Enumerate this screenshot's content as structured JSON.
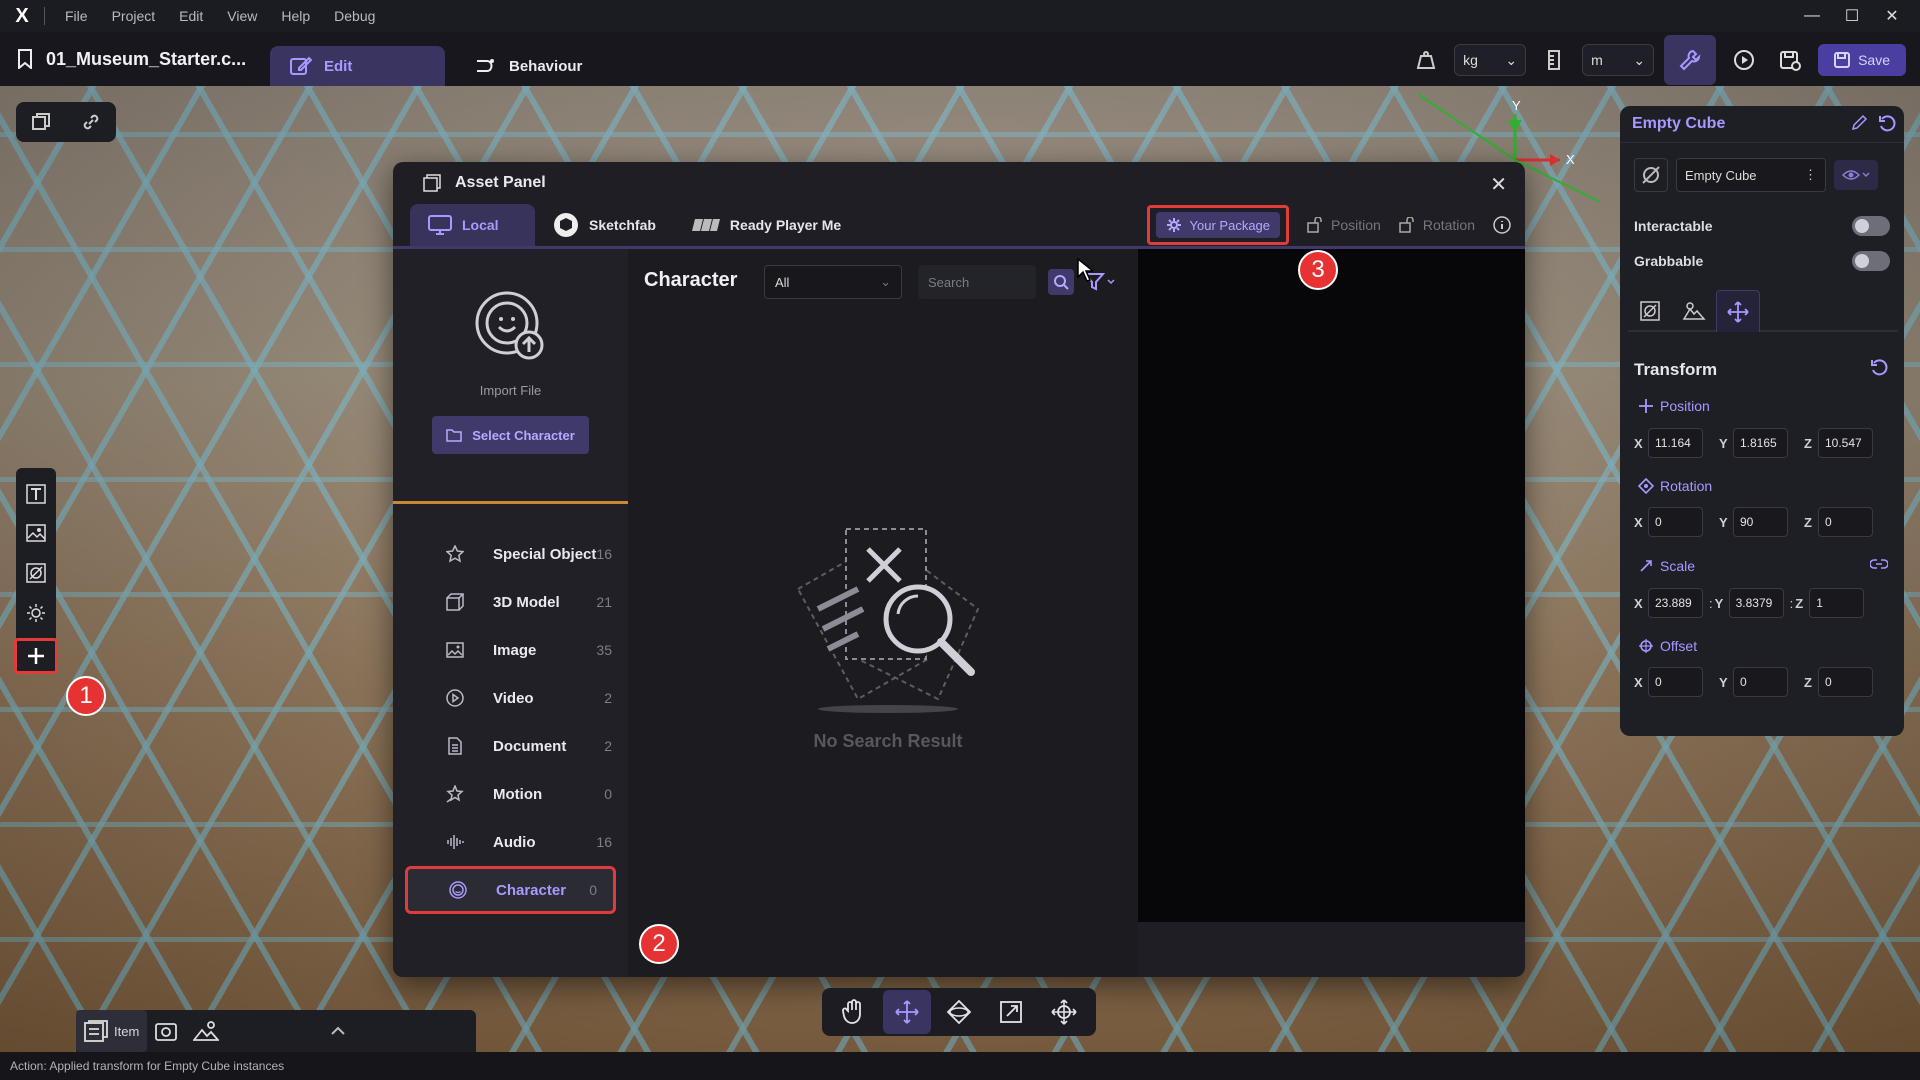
{
  "menubar": {
    "logo": "X",
    "items": [
      "File",
      "Project",
      "Edit",
      "View",
      "Help",
      "Debug"
    ]
  },
  "toolbar": {
    "project_name": "01_Museum_Starter.c...",
    "tabs": {
      "edit": "Edit",
      "behaviour": "Behaviour"
    },
    "mass_unit": "kg",
    "length_unit": "m",
    "save_label": "Save"
  },
  "asset_panel": {
    "title": "Asset Panel",
    "tabs": {
      "local": "Local",
      "sketchfab": "Sketchfab",
      "ready_player_me": "Ready Player Me"
    },
    "right_tabs": {
      "your_package": "Your Package",
      "position": "Position",
      "rotation": "Rotation"
    },
    "import_label": "Import File",
    "select_button": "Select Character",
    "categories": [
      {
        "name": "Special Object",
        "count": "16",
        "icon": "star-icon"
      },
      {
        "name": "3D Model",
        "count": "21",
        "icon": "cube-icon"
      },
      {
        "name": "Image",
        "count": "35",
        "icon": "image-icon"
      },
      {
        "name": "Video",
        "count": "2",
        "icon": "play-icon"
      },
      {
        "name": "Document",
        "count": "2",
        "icon": "document-icon"
      },
      {
        "name": "Motion",
        "count": "0",
        "icon": "motion-icon"
      },
      {
        "name": "Audio",
        "count": "16",
        "icon": "audio-icon"
      },
      {
        "name": "Character",
        "count": "0",
        "icon": "character-icon"
      }
    ],
    "content_title": "Character",
    "filter_value": "All",
    "search_placeholder": "Search",
    "empty_text": "No Search Result"
  },
  "badges": [
    "1",
    "2",
    "3"
  ],
  "properties": {
    "title": "Empty Cube",
    "object_name": "Empty Cube",
    "interactable_label": "Interactable",
    "grabbable_label": "Grabbable",
    "section_title": "Transform",
    "position": {
      "label": "Position",
      "x": "11.164",
      "y": "1.8165",
      "z": "10.547"
    },
    "rotation": {
      "label": "Rotation",
      "x": "0",
      "y": "90",
      "z": "0"
    },
    "scale": {
      "label": "Scale",
      "x": "23.889",
      "y": "3.8379",
      "z": "1"
    },
    "offset": {
      "label": "Offset",
      "x": "0",
      "y": "0",
      "z": "0"
    },
    "axes": {
      "x": "X",
      "y": "Y",
      "z": "Z"
    }
  },
  "gizmo": {
    "y": "Y",
    "x": "X"
  },
  "dock": {
    "item_label": "Item"
  },
  "status_text": "Action: Applied transform for Empty Cube instances",
  "colors": {
    "accent": "#a799ff",
    "highlight": "#e23b3b",
    "panel": "#1e1e24"
  }
}
